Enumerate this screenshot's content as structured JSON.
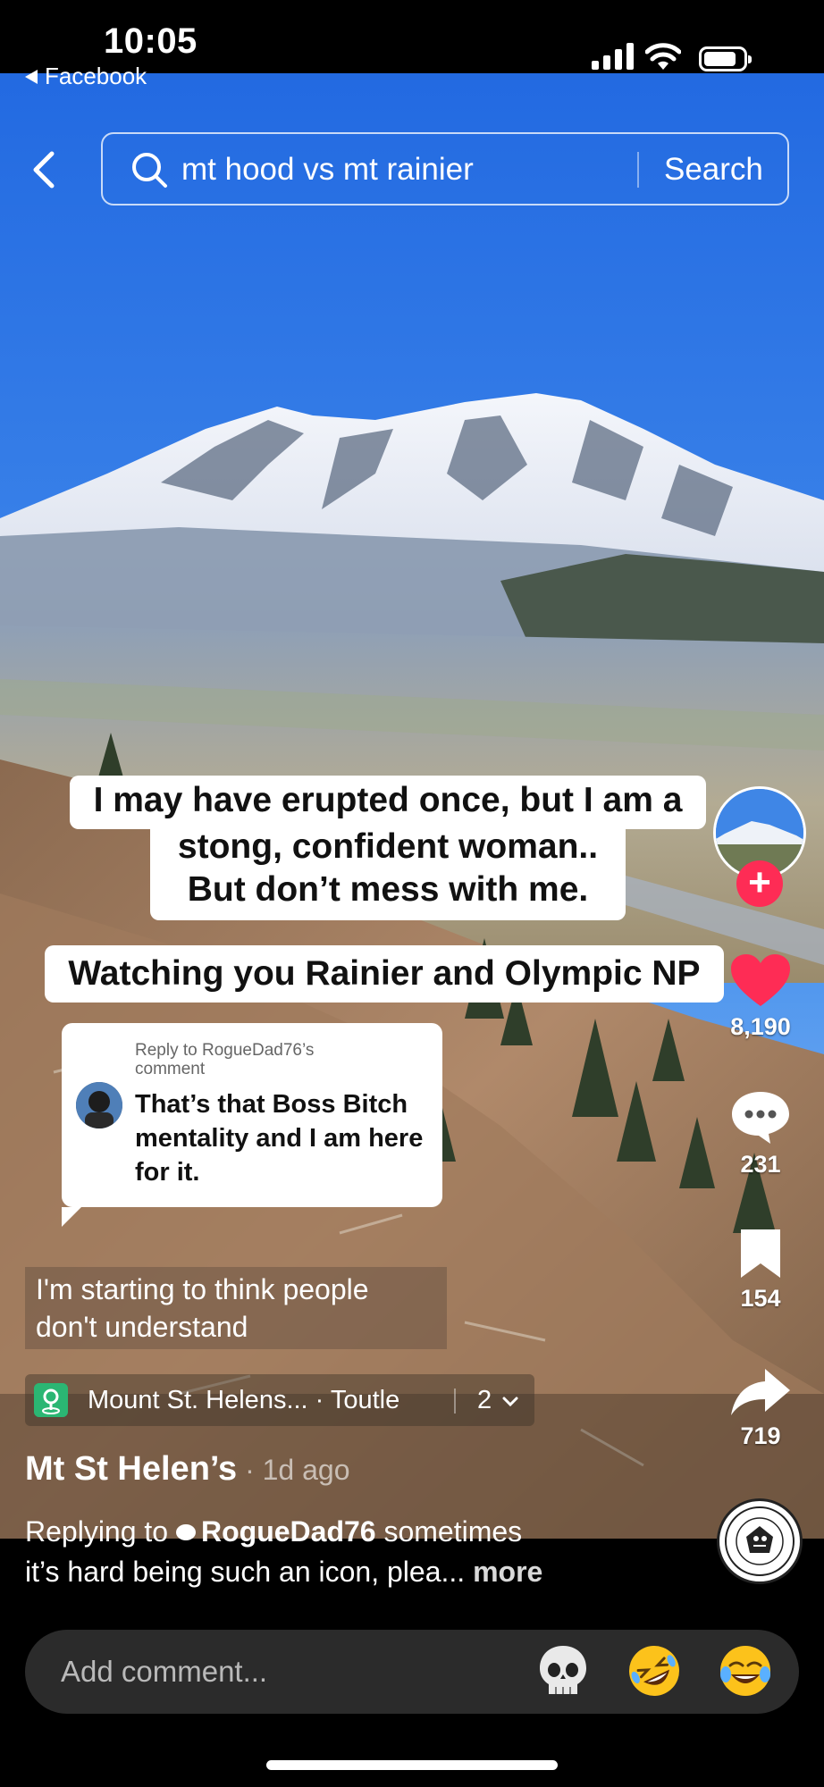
{
  "status_bar": {
    "time": "10:05",
    "back_app": "Facebook"
  },
  "search": {
    "query": "mt hood vs mt rainier",
    "button": "Search"
  },
  "captions": {
    "caption1_line1": "I may have erupted once, but I am a",
    "caption1_line2": "stong, confident woman..",
    "caption1_line3": "But don’t mess with me.",
    "caption2": "Watching you Rainier and Olympic NP"
  },
  "reply_bubble": {
    "reply_to": "Reply to RogueDad76’s comment",
    "message": "That’s that Boss Bitch mentality and I am here for it."
  },
  "subtitle": {
    "line1": "I'm starting to think people",
    "line2": "don't understand"
  },
  "location": {
    "name": "Mount St. Helens... · Toutle",
    "count": "2"
  },
  "post": {
    "author": "Mt St Helen’s",
    "time_ago": " · 1d ago",
    "desc_prefix": "Replying to ",
    "reply_handle": "RogueDad76",
    "desc_line1_rest": " sometimes",
    "desc_line2": "it’s hard being such an icon, plea...",
    "more": "more"
  },
  "actions": {
    "likes": "8,190",
    "comments": "231",
    "saves": "154",
    "shares": "719"
  },
  "comment_bar": {
    "placeholder": "Add comment..."
  },
  "emoji": {
    "e1": "skull",
    "e2": "rolling-on-floor-laughing",
    "e3": "tears-of-joy"
  },
  "colors": {
    "like_red": "#fe2c55",
    "sky_top": "#1f66e0",
    "location_green": "#2bb673"
  }
}
